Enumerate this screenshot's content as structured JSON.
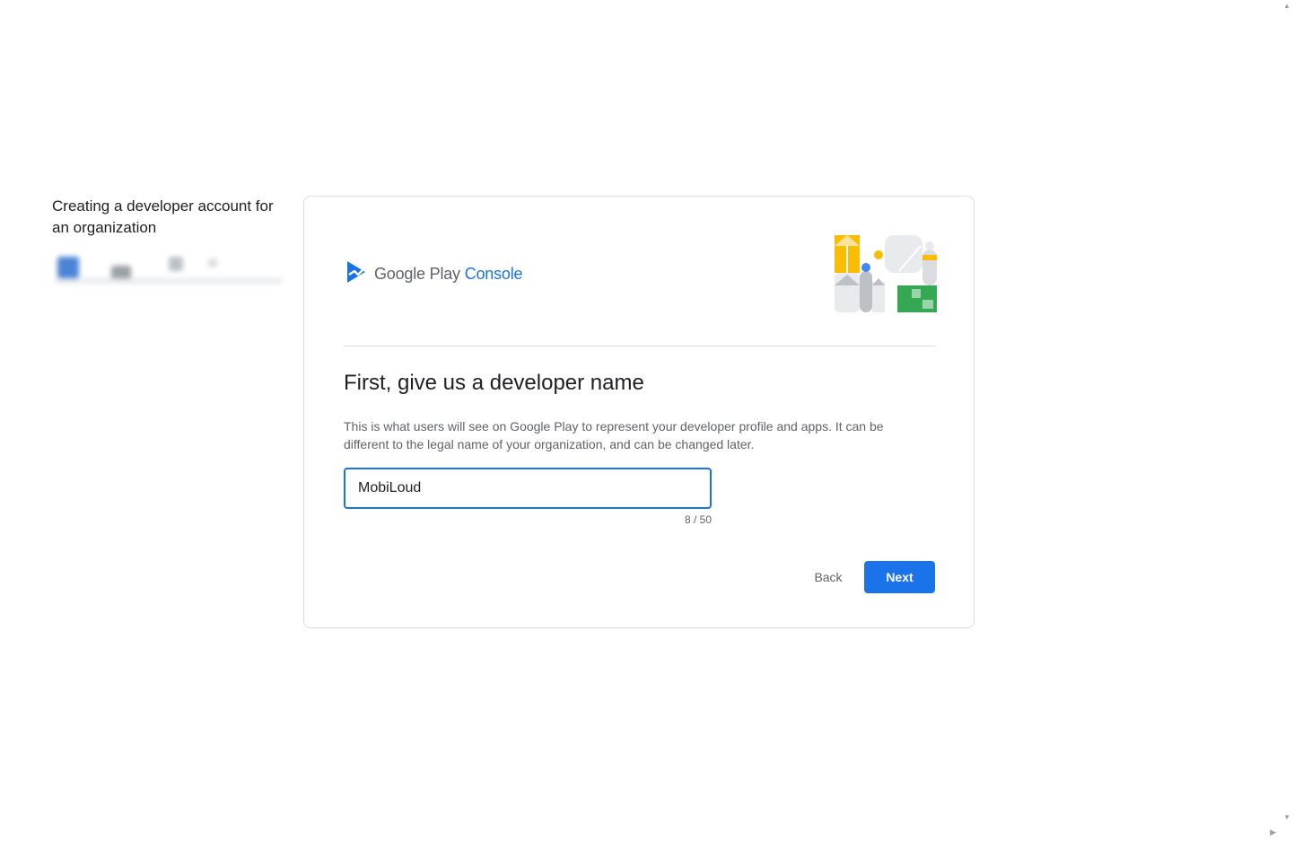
{
  "sidebar": {
    "title": "Creating a developer account for an organization"
  },
  "logo": {
    "brand": "Google Play",
    "product": "Console"
  },
  "form": {
    "heading": "First, give us a developer name",
    "description": "This is what users will see on Google Play to represent your developer profile and apps. It can be different to the legal name of your organization, and can be changed later.",
    "developer_name_value": "MobiLoud",
    "char_counter": "8 / 50"
  },
  "actions": {
    "back_label": "Back",
    "next_label": "Next"
  },
  "colors": {
    "accent": "#1a73e8",
    "yellow": "#fbbc04",
    "green": "#34a853",
    "grey": "#dadce0"
  }
}
